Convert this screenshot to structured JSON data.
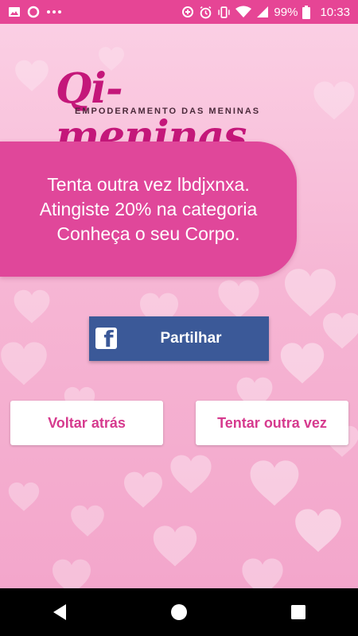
{
  "status_bar": {
    "battery": "99%",
    "time": "10:33",
    "icons": [
      "image-icon",
      "circle-icon",
      "more-dots-icon",
      "data-saver-icon",
      "alarm-icon",
      "vibrate-icon",
      "wifi-icon",
      "signal-icon",
      "battery-icon"
    ]
  },
  "logo": {
    "brand": "Qi-meninas",
    "tagline": "EMPODERAMENTO DAS MENINAS"
  },
  "result": {
    "message": "Tenta outra vez lbdjxnxa. Atingiste 20% na categoria Conheça o seu Corpo."
  },
  "share": {
    "label": "Partilhar",
    "icon": "facebook-icon",
    "color": "#3b5998"
  },
  "actions": {
    "back_label": "Voltar atrás",
    "retry_label": "Tentar outra vez"
  },
  "colors": {
    "accent": "#e0479a",
    "status_bar": "#e64595",
    "button_text": "#d63a8e"
  },
  "nav": {
    "icons": [
      "back-icon",
      "home-icon",
      "recents-icon"
    ]
  }
}
